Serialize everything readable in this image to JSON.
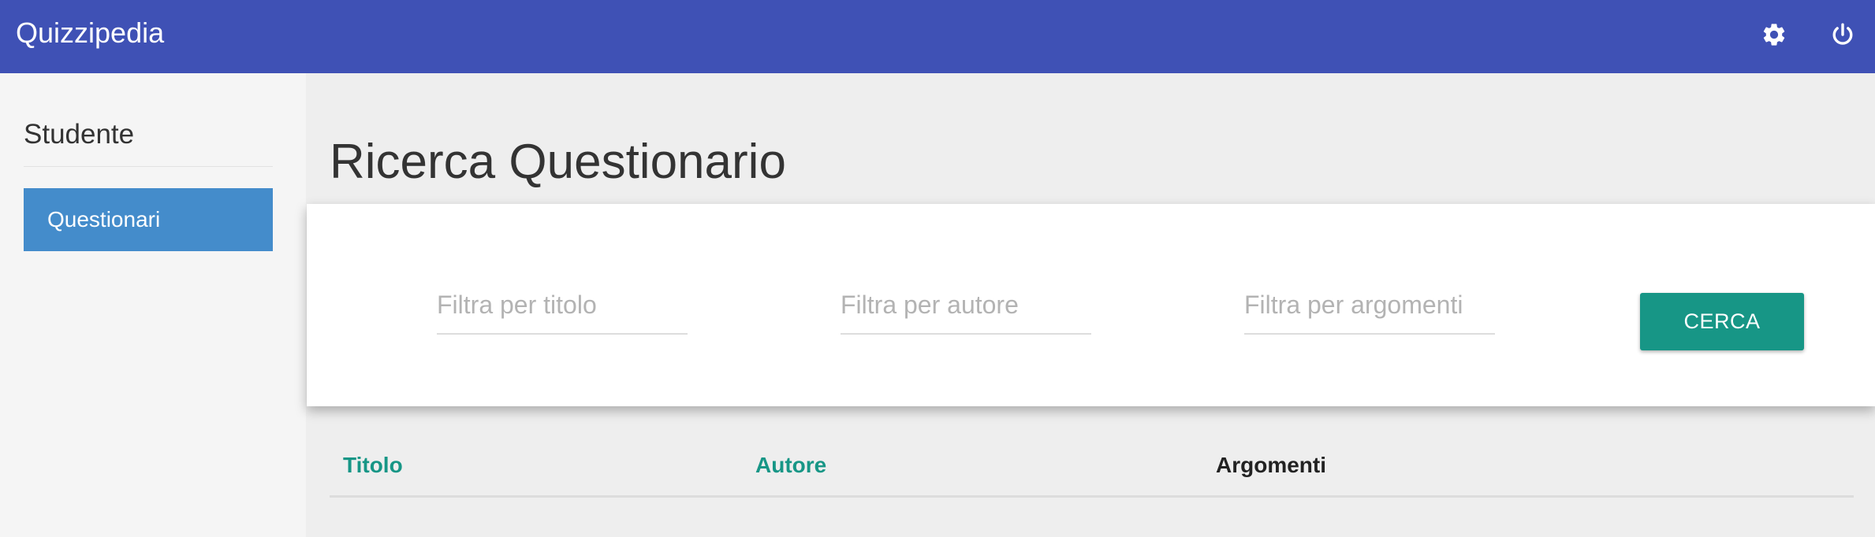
{
  "header": {
    "app_title": "Quizzipedia",
    "settings_icon": "gear-icon",
    "power_icon": "power-icon",
    "colors": {
      "background": "#3f51b5",
      "text": "#ffffff"
    }
  },
  "sidebar": {
    "heading": "Studente",
    "items": [
      {
        "label": "Questionari",
        "active": true
      }
    ],
    "colors": {
      "active_item": "#448ccb",
      "background": "#f5f5f5"
    }
  },
  "main": {
    "page_title": "Ricerca Questionario",
    "filters": {
      "title_placeholder": "Filtra per titolo",
      "author_placeholder": "Filtra per autore",
      "topics_placeholder": "Filtra per argomenti",
      "title_value": "",
      "author_value": "",
      "topics_value": ""
    },
    "search_button_label": "CERCA",
    "table": {
      "columns": [
        "Titolo",
        "Autore",
        "Argomenti"
      ],
      "rows": []
    },
    "colors": {
      "accent": "#179686",
      "background": "#eeeeee"
    }
  }
}
